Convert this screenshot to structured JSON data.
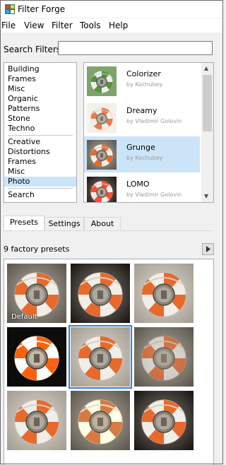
{
  "window": {
    "title": "Filter Forge"
  },
  "menu": [
    "File",
    "View",
    "Filter",
    "Tools",
    "Help"
  ],
  "search": {
    "label": "Search Filters:",
    "value": ""
  },
  "categories": {
    "group1": [
      "Building",
      "Frames",
      "Misc",
      "Organic",
      "Patterns",
      "Stone",
      "Techno"
    ],
    "group2": [
      "Creative",
      "Distortions",
      "Frames",
      "Misc",
      "Photo"
    ],
    "search": "Search",
    "selected": "Photo"
  },
  "filters": [
    {
      "name": "Colorizer",
      "author": "by Kochubey",
      "icon": "colorizer-lifebuoy-thumbnail"
    },
    {
      "name": "Dreamy",
      "author": "by Vladimir Golovin",
      "icon": "dreamy-lifebuoy-thumbnail"
    },
    {
      "name": "Grunge",
      "author": "by Kochubey",
      "icon": "grunge-lifebuoy-thumbnail",
      "selected": true
    },
    {
      "name": "LOMO",
      "author": "by Vladimir Golovin",
      "icon": "lomo-lifebuoy-thumbnail"
    }
  ],
  "tabs": [
    {
      "label": "Presets",
      "active": true
    },
    {
      "label": "Settings",
      "active": false
    },
    {
      "label": "About",
      "active": false
    }
  ],
  "presets": {
    "count_label": "9 factory presets",
    "first_label": "Default",
    "selected_index": 4,
    "items": [
      {
        "variant": "grunge-default"
      },
      {
        "variant": "grunge-dark"
      },
      {
        "variant": "grunge-light"
      },
      {
        "variant": "grunge-high-contrast"
      },
      {
        "variant": "grunge-soft"
      },
      {
        "variant": "grunge-faded"
      },
      {
        "variant": "grunge-worn"
      },
      {
        "variant": "grunge-warm"
      },
      {
        "variant": "grunge-vignette"
      }
    ]
  },
  "colors": {
    "accent": "#2f80d6",
    "selection": "#cce4f7",
    "orange": "#e8692c"
  }
}
